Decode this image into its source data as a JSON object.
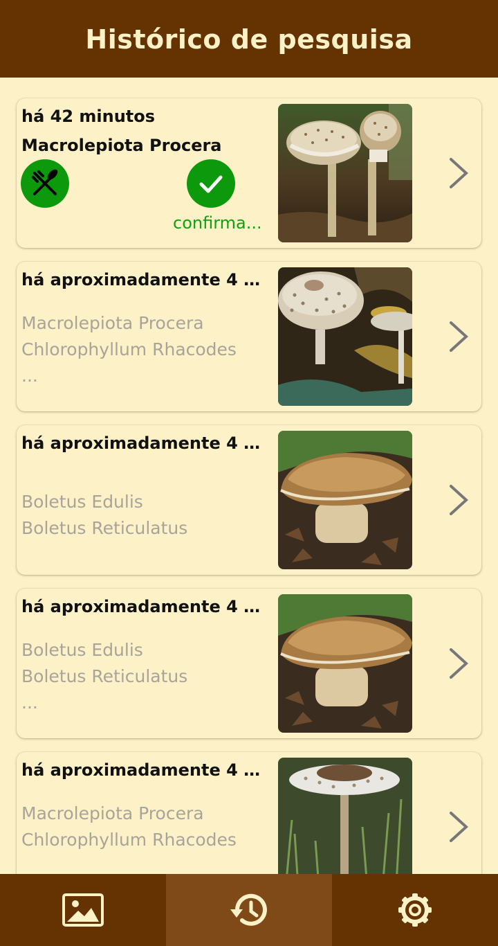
{
  "app_bar": {
    "title": "Histórico de pesquisa"
  },
  "history": [
    {
      "time": "há 42 minutos",
      "species": "Macrolepiota Procera",
      "edible_icon": "fork-knife-icon",
      "confirmed_icon": "check-icon",
      "status": "confirma...",
      "thumbnail": "parasol-mushroom-photo"
    },
    {
      "time": "há aproximadamente 4 h...",
      "candidates": [
        "Macrolepiota Procera",
        "Chlorophyllum Rhacodes"
      ],
      "more": "...",
      "thumbnail": "parasol-mushroom-cap-photo"
    },
    {
      "time": "há aproximadamente 4 h...",
      "candidates": [
        "Boletus Edulis",
        "Boletus Reticulatus"
      ],
      "thumbnail": "porcini-mushroom-photo"
    },
    {
      "time": "há aproximadamente 4 h...",
      "candidates": [
        "Boletus Edulis",
        "Boletus Reticulatus"
      ],
      "more": "...",
      "thumbnail": "porcini-mushroom-photo"
    },
    {
      "time": "há aproximadamente 4 h...",
      "candidates": [
        "Macrolepiota Procera",
        "Chlorophyllum Rhacodes"
      ],
      "thumbnail": "parasol-mushroom-grass-photo"
    }
  ],
  "bottom_nav": [
    {
      "icon": "image-icon",
      "active": false
    },
    {
      "icon": "history-icon",
      "active": true
    },
    {
      "icon": "gear-icon",
      "active": false
    }
  ],
  "colors": {
    "primary": "#653302",
    "active_tab": "#7f4a18",
    "background": "#fdf1c8",
    "on_primary": "#fdf1c8",
    "confirmed_green": "#0c9a0c",
    "candidate_text": "#a9a49a",
    "chevron": "#777777"
  }
}
